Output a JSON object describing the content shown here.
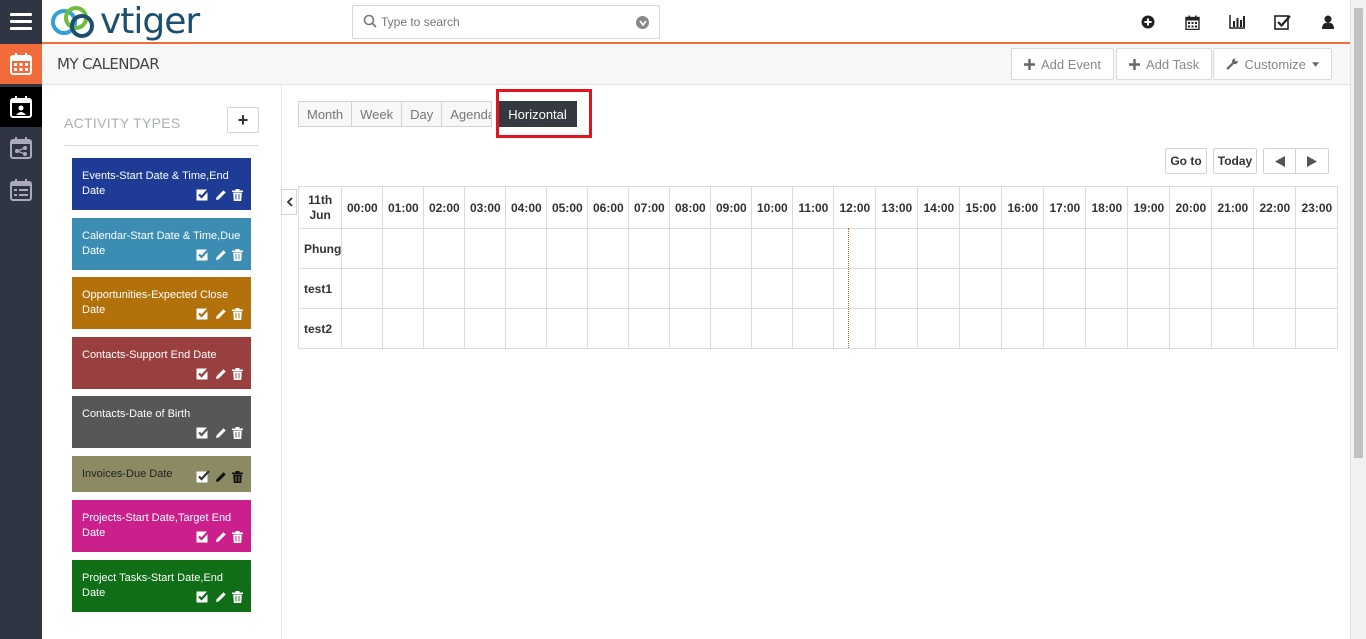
{
  "header": {
    "logo_text": "vtiger",
    "search": {
      "placeholder": "Type to search"
    }
  },
  "subheader": {
    "title": "MY CALENDAR",
    "buttons": {
      "add_event": "Add Event",
      "add_task": "Add Task",
      "customize": "Customize"
    }
  },
  "sidebar": {
    "title": "ACTIVITY TYPES",
    "add_label": "+",
    "activity_types": [
      {
        "label": "Events-Start Date & Time,End Date",
        "color": "#1e3b96"
      },
      {
        "label": "Calendar-Start Date & Time,Due Date",
        "color": "#3c8db4"
      },
      {
        "label": "Opportunities-Expected Close Date",
        "color": "#b2710b"
      },
      {
        "label": "Contacts-Support End Date",
        "color": "#9a3f3f"
      },
      {
        "label": "Contacts-Date of Birth",
        "color": "#575757"
      },
      {
        "label": "Invoices-Due Date",
        "color": "#8b8a62"
      },
      {
        "label": "Projects-Start Date,Target End Date",
        "color": "#cb1f8c"
      },
      {
        "label": "Project Tasks-Start Date,End Date",
        "color": "#0f6e16"
      }
    ]
  },
  "views": {
    "tabs": [
      "Month",
      "Week",
      "Day",
      "Agenda",
      "Horizontal"
    ],
    "active": "Horizontal"
  },
  "nav": {
    "goto": "Go to",
    "today": "Today"
  },
  "timeline": {
    "date_label": "11th\nJun",
    "hours": [
      "00:00",
      "01:00",
      "02:00",
      "03:00",
      "04:00",
      "05:00",
      "06:00",
      "07:00",
      "08:00",
      "09:00",
      "10:00",
      "11:00",
      "12:00",
      "13:00",
      "14:00",
      "15:00",
      "16:00",
      "17:00",
      "18:00",
      "19:00",
      "20:00",
      "21:00",
      "22:00",
      "23:00"
    ],
    "resources": [
      "Phung",
      "test1",
      "test2"
    ]
  },
  "colors": {
    "accent": "#f26b3a",
    "rail": "#2f3542",
    "highlight": "#e0141e"
  }
}
